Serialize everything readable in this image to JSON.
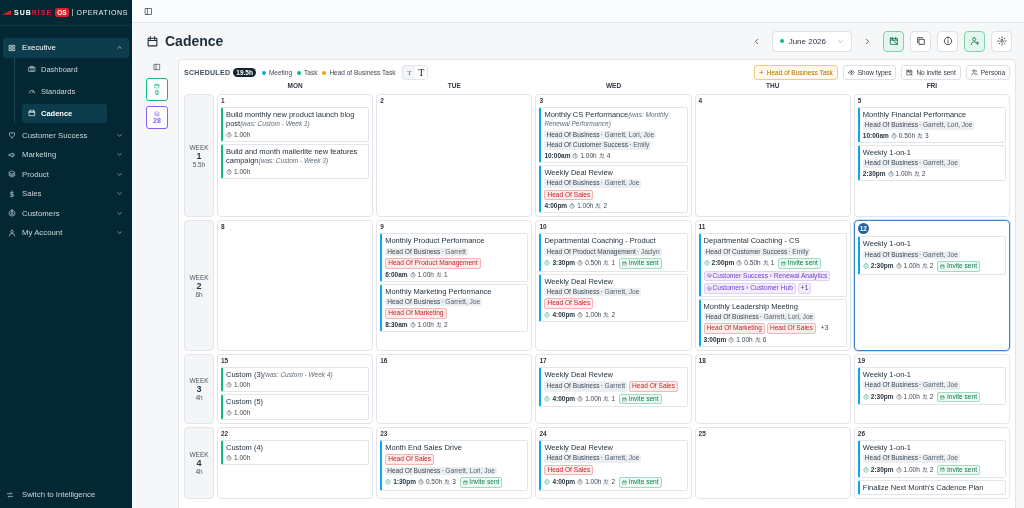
{
  "sidebar": {
    "logo": {
      "left": "SUB",
      "right": "RISE",
      "badge": "OS",
      "product": "OPERATIONS"
    },
    "items": [
      {
        "label": "Executive",
        "expanded": true,
        "children": [
          {
            "label": "Dashboard",
            "selected": false
          },
          {
            "label": "Standards",
            "selected": false
          },
          {
            "label": "Cadence",
            "selected": true
          }
        ]
      },
      {
        "label": "Customer Success",
        "expanded": false
      },
      {
        "label": "Marketing",
        "expanded": false
      },
      {
        "label": "Product",
        "expanded": false
      },
      {
        "label": "Sales",
        "expanded": false
      },
      {
        "label": "Customers",
        "expanded": false
      },
      {
        "label": "My Account",
        "expanded": false
      }
    ],
    "footer": "Switch to Intelligence"
  },
  "page": {
    "title": "Cadence",
    "month": "June 2026",
    "toolbar": [
      {
        "active": true
      },
      {
        "active": false
      },
      {
        "active": false
      },
      {
        "active": true
      },
      {
        "active": false
      }
    ]
  },
  "rail": {
    "badges": [
      {
        "count": "0",
        "color": "#10b981"
      },
      {
        "count": "28",
        "color": "#8b5cf6"
      }
    ]
  },
  "calendar": {
    "scheduled_label": "SCHEDULED",
    "scheduled_hours": "19.5h",
    "legend": [
      {
        "label": "Meeting",
        "color": "#0ea5e9"
      },
      {
        "label": "Task",
        "color": "#10b981"
      },
      {
        "label": "Head of Business Task",
        "color": "#f59e0b"
      }
    ],
    "text_size": [
      {
        "label": "T",
        "selected": false
      },
      {
        "label": "T",
        "selected": true
      }
    ],
    "actions": [
      {
        "label": "+",
        "kind": "add",
        "text": "Head of Business Task"
      },
      {
        "kind": "eye",
        "text": "Show types"
      },
      {
        "kind": "noinvite",
        "text": "No invite sent"
      },
      {
        "kind": "persona",
        "text": "Persona"
      }
    ],
    "weekdays": [
      "MON",
      "TUE",
      "WED",
      "THU",
      "FRI"
    ],
    "weeks": [
      {
        "label": "WEEK",
        "number": "1",
        "hours": "5.5h",
        "days": [
          {
            "date": "1",
            "today": false,
            "events": [
              {
                "kind": "task",
                "title": "Build monthly new product launch blog post",
                "was": "(was: Custom - Week 1)",
                "duration": "1.00h"
              },
              {
                "kind": "task",
                "title": "Build and month mailerlite new features campaign",
                "was": "(was: Custom - Week 3)",
                "duration": "1.00h"
              }
            ]
          },
          {
            "date": "2",
            "today": false
          },
          {
            "date": "3",
            "today": false,
            "events": [
              {
                "kind": "meeting",
                "title": "Monthly CS Performance",
                "was": "(was: Monthly Renewal Performance)",
                "tags": [
                  {
                    "kind": "role",
                    "label": "Head Of Business",
                    "people": "· Garrett, Lori, Joe"
                  },
                  {
                    "kind": "role",
                    "label": "Head Of Customer Success",
                    "people": "· Emily"
                  }
                ],
                "confirmed": false,
                "time": "10:00am",
                "duration": "1.00h",
                "attendees": "4",
                "invite": false
              },
              {
                "kind": "meeting",
                "title": "Weekly Deal Review",
                "tags": [
                  {
                    "kind": "role",
                    "label": "Head Of Business",
                    "people": "· Garrett, Joe"
                  },
                  {
                    "kind": "alert",
                    "label": "Head Of Sales"
                  }
                ],
                "confirmed": false,
                "time": "4:00pm",
                "duration": "1.00h",
                "attendees": "2",
                "invite": false
              }
            ]
          },
          {
            "date": "4",
            "today": false
          },
          {
            "date": "5",
            "today": false,
            "events": [
              {
                "kind": "meeting",
                "title": "Monthly Financial Performance",
                "tags": [
                  {
                    "kind": "role",
                    "label": "Head Of Business",
                    "people": "· Garrett, Lori, Joe"
                  }
                ],
                "confirmed": false,
                "time": "10:00am",
                "duration": "0.50h",
                "attendees": "3",
                "invite": false
              },
              {
                "kind": "meeting",
                "title": "Weekly 1-on-1",
                "tags": [
                  {
                    "kind": "role",
                    "label": "Head Of Business",
                    "people": "· Garrett, Joe"
                  }
                ],
                "confirmed": false,
                "time": "2:30pm",
                "duration": "1.00h",
                "attendees": "2",
                "invite": false
              }
            ]
          }
        ]
      },
      {
        "label": "WEEK",
        "number": "2",
        "hours": "6h",
        "days": [
          {
            "date": "8",
            "today": false
          },
          {
            "date": "9",
            "today": false,
            "events": [
              {
                "kind": "meeting",
                "title": "Monthly Product Performance",
                "tags": [
                  {
                    "kind": "role",
                    "label": "Head Of Business",
                    "people": "· Garrett"
                  },
                  {
                    "kind": "alert",
                    "label": "Head Of Product Management"
                  }
                ],
                "confirmed": false,
                "time": "6:00am",
                "duration": "1.00h",
                "attendees": "1",
                "invite": false
              },
              {
                "kind": "meeting",
                "title": "Monthly Marketing Performance",
                "tags": [
                  {
                    "kind": "role",
                    "label": "Head Of Business",
                    "people": "· Garrett, Joe"
                  },
                  {
                    "kind": "alert",
                    "label": "Head Of Marketing"
                  }
                ],
                "confirmed": false,
                "time": "8:30am",
                "duration": "1.00h",
                "attendees": "2",
                "invite": false
              }
            ]
          },
          {
            "date": "10",
            "today": false,
            "events": [
              {
                "kind": "meeting",
                "title": "Departmental Coaching - Product",
                "tags": [
                  {
                    "kind": "role",
                    "label": "Head Of Product Management",
                    "people": "· Jaclyn"
                  }
                ],
                "confirmed": true,
                "time": "3:30pm",
                "duration": "0.50h",
                "attendees": "1",
                "invite": true,
                "invite_text": "Invite sent"
              },
              {
                "kind": "meeting",
                "title": "Weekly Deal Review",
                "tags": [
                  {
                    "kind": "role",
                    "label": "Head Of Business",
                    "people": "· Garrett, Joe"
                  },
                  {
                    "kind": "alert",
                    "label": "Head Of Sales"
                  }
                ],
                "confirmed": true,
                "time": "4:00pm",
                "duration": "1.00h",
                "attendees": "2",
                "invite": false
              }
            ]
          },
          {
            "date": "11",
            "today": false,
            "events": [
              {
                "kind": "meeting",
                "title": "Departmental Coaching - CS",
                "tags": [
                  {
                    "kind": "role",
                    "label": "Head Of Customer Success",
                    "people": "· Emily"
                  }
                ],
                "confirmed": true,
                "time": "2:00pm",
                "duration": "0.50h",
                "attendees": "1",
                "invite": true,
                "invite_text": "Invite sent",
                "modules": [
                  {
                    "kind": "module",
                    "label": "Customer Success › Renewal Analytics"
                  },
                  {
                    "kind": "module",
                    "label": "Customers › Customer Hub"
                  },
                  {
                    "kind": "more",
                    "label": "+1"
                  }
                ]
              },
              {
                "kind": "meeting",
                "title": "Monthly Leadership Meeting",
                "tags": [
                  {
                    "kind": "role",
                    "label": "Head Of Business",
                    "people": "· Garrett, Lori, Joe"
                  },
                  {
                    "kind": "alert",
                    "label": "Head Of Marketing"
                  },
                  {
                    "kind": "alert",
                    "label": "Head Of Sales"
                  },
                  {
                    "kind": "more",
                    "label": "+3"
                  }
                ],
                "confirmed": false,
                "time": "3:00pm",
                "duration": "1.00h",
                "attendees": "6",
                "invite": false
              }
            ]
          },
          {
            "date": "12",
            "today": true,
            "events": [
              {
                "kind": "meeting",
                "title": "Weekly 1-on-1",
                "tags": [
                  {
                    "kind": "role",
                    "label": "Head Of Business",
                    "people": "· Garrett, Joe"
                  }
                ],
                "confirmed": true,
                "time": "2:30pm",
                "duration": "1.00h",
                "attendees": "2",
                "invite": true,
                "invite_text": "Invite sent"
              }
            ]
          }
        ]
      },
      {
        "label": "WEEK",
        "number": "3",
        "hours": "4h",
        "days": [
          {
            "date": "15",
            "today": false,
            "events": [
              {
                "kind": "task",
                "title": "Custom (3)",
                "was": "(was: Custom - Week 4)",
                "duration": "1.00h"
              },
              {
                "kind": "task",
                "title": "Custom (5)",
                "duration": "1.00h"
              }
            ]
          },
          {
            "date": "16",
            "today": false
          },
          {
            "date": "17",
            "today": false,
            "events": [
              {
                "kind": "meeting",
                "title": "Weekly Deal Review",
                "tags": [
                  {
                    "kind": "role",
                    "label": "Head Of Business",
                    "people": "· Garrett"
                  },
                  {
                    "kind": "alert",
                    "label": "Head Of Sales"
                  }
                ],
                "confirmed": true,
                "time": "4:00pm",
                "duration": "1.00h",
                "attendees": "1",
                "invite": true,
                "invite_text": "Invite sent"
              }
            ]
          },
          {
            "date": "18",
            "today": false
          },
          {
            "date": "19",
            "today": false,
            "events": [
              {
                "kind": "meeting",
                "title": "Weekly 1-on-1",
                "tags": [
                  {
                    "kind": "role",
                    "label": "Head Of Business",
                    "people": "· Garrett, Joe"
                  }
                ],
                "confirmed": true,
                "time": "2:30pm",
                "duration": "1.00h",
                "attendees": "2",
                "invite": true,
                "invite_text": "Invite sent"
              }
            ]
          }
        ]
      },
      {
        "label": "WEEK",
        "number": "4",
        "hours": "4h",
        "days": [
          {
            "date": "22",
            "today": false,
            "events": [
              {
                "kind": "task",
                "title": "Custom (4)",
                "duration": "1.00h"
              }
            ]
          },
          {
            "date": "23",
            "today": false,
            "events": [
              {
                "kind": "meeting",
                "title": "Month End Sales Drive",
                "tags": [
                  {
                    "kind": "alert",
                    "label": "Head Of Sales"
                  },
                  {
                    "kind": "role",
                    "label": "Head Of Business",
                    "people": "· Garrett, Lori, Joe"
                  }
                ],
                "confirmed": true,
                "time": "1:30pm",
                "duration": "0.50h",
                "attendees": "3",
                "invite": true,
                "invite_text": "Invite sent"
              }
            ]
          },
          {
            "date": "24",
            "today": false,
            "events": [
              {
                "kind": "meeting",
                "title": "Weekly Deal Review",
                "tags": [
                  {
                    "kind": "role",
                    "label": "Head Of Business",
                    "people": "· Garrett, Joe"
                  },
                  {
                    "kind": "alert",
                    "label": "Head Of Sales"
                  }
                ],
                "confirmed": true,
                "time": "4:00pm",
                "duration": "1.00h",
                "attendees": "2",
                "invite": true,
                "invite_text": "Invite sent"
              }
            ]
          },
          {
            "date": "25",
            "today": false
          },
          {
            "date": "26",
            "today": false,
            "events": [
              {
                "kind": "meeting",
                "title": "Weekly 1-on-1",
                "tags": [
                  {
                    "kind": "role",
                    "label": "Head Of Business",
                    "people": "· Garrett, Joe"
                  }
                ],
                "confirmed": true,
                "time": "2:30pm",
                "duration": "1.00h",
                "attendees": "2",
                "invite": true,
                "invite_text": "Invite sent"
              },
              {
                "kind": "meeting",
                "title": "Finalize Next Month's Cadence Plan"
              }
            ]
          }
        ]
      }
    ]
  }
}
